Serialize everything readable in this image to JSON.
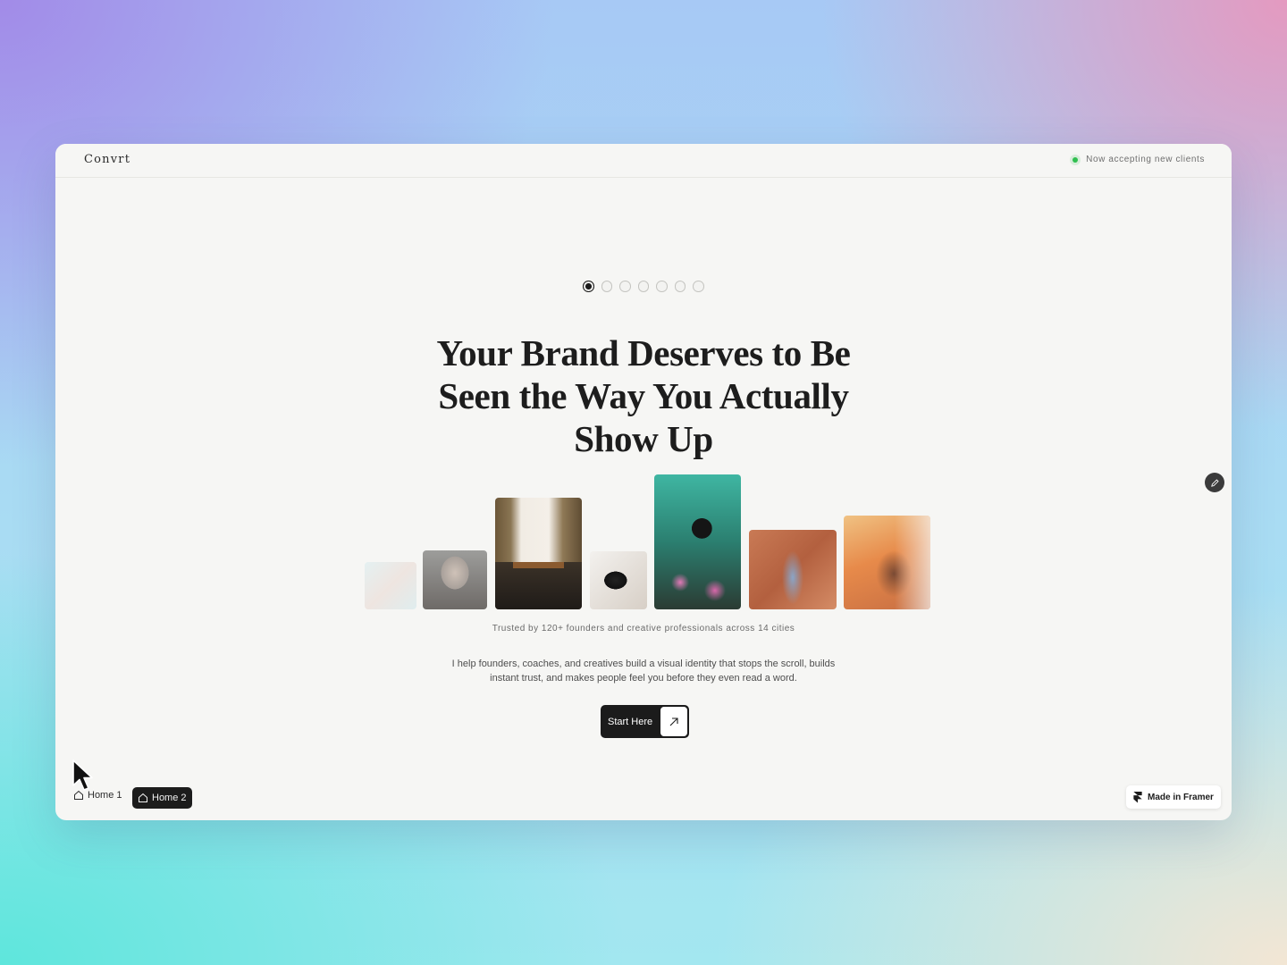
{
  "header": {
    "brand": "Convrt",
    "status_text": "Now accepting new clients",
    "status_color": "#2fbf4f"
  },
  "carousel": {
    "dot_count": 7,
    "active_index": 0
  },
  "hero": {
    "headline_lines": [
      "Your Brand Deserves to Be",
      "Seen the Way You Actually",
      "Show Up"
    ]
  },
  "gallery": {
    "photos": [
      "portrait-sea",
      "portrait-hand-on-face",
      "outfit-belt",
      "camera-hand",
      "photographer-flowers",
      "photographer-orange-wall",
      "portrait-car"
    ]
  },
  "trusted_text": "Trusted by 120+ founders and creative professionals across 14 cities",
  "description": "I help founders, coaches, and creatives build a visual identity that stops the scroll, builds instant trust, and makes people feel you before they even read a word.",
  "cta": {
    "label": "Start Here",
    "icon": "arrow-up-right-icon"
  },
  "page_switcher": {
    "home1": "Home 1",
    "home2": "Home 2"
  },
  "badge": {
    "label": "Made in Framer"
  },
  "colors": {
    "page_bg": "#f6f6f4",
    "dark": "#1c1c1c"
  }
}
